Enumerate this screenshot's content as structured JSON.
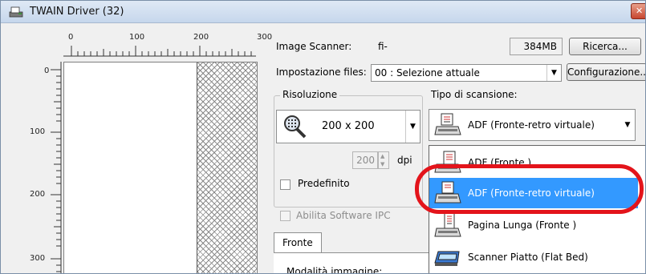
{
  "window": {
    "title": "TWAIN Driver (32)",
    "close_glyph": "✕"
  },
  "ruler": {
    "top": [
      "0",
      "100",
      "200",
      "300"
    ],
    "left": [
      "0",
      "100",
      "200",
      "300"
    ]
  },
  "scanner": {
    "label": "Image Scanner:",
    "model": "fi-",
    "memory": "384MB",
    "search_button": "Ricerca..."
  },
  "files": {
    "label": "Impostazione files:",
    "value": "00 : Selezione attuale",
    "config_button": "Configurazione..."
  },
  "resolution": {
    "group_label": "Risoluzione",
    "value": "200 x 200",
    "custom_value": "200",
    "unit": "dpi",
    "default_label": "Predefinito"
  },
  "scan_type": {
    "label": "Tipo di scansione:",
    "value": "ADF (Fronte-retro virtuale)",
    "options": [
      {
        "label": "ADF (Fronte )",
        "icon": "adf-front-icon"
      },
      {
        "label": "ADF (Fronte-retro virtuale)",
        "icon": "adf-duplex-icon"
      },
      {
        "label": "Pagina Lunga (Fronte )",
        "icon": "long-page-icon"
      },
      {
        "label": "Scanner Piatto (Flat Bed)",
        "icon": "flatbed-icon"
      }
    ],
    "selected_index": 1
  },
  "ipc": {
    "label": "Abilita Software IPC"
  },
  "tabs": {
    "front": "Fronte"
  },
  "image_mode": {
    "label": "Modalità immagine:"
  },
  "colors": {
    "selection": "#3399ff",
    "highlight_ring": "#e3141b"
  }
}
